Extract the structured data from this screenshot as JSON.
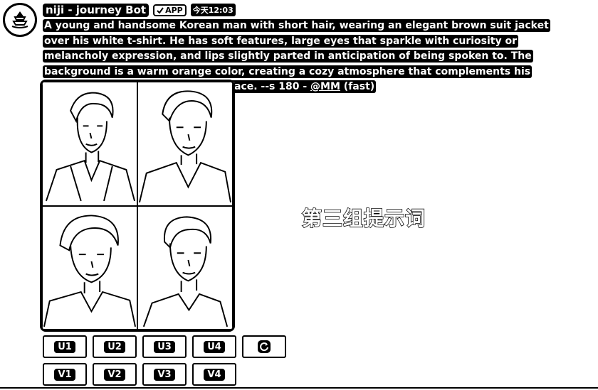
{
  "header": {
    "bot_name": "niji - journey Bot",
    "badge": "APP",
    "timestamp": "今天12:03",
    "avatar_icon": "boat-avatar-icon"
  },
  "message": {
    "prompt_text": "A young and handsome Korean man with short hair, wearing an elegant brown suit jacket over his white t-shirt. He has soft features, large eyes that sparkle with curiosity or melancholy expression, and lips slightly parted in anticipation of being spoken to. The background is a warm orange color, creating a cozy atmosphere that complements his overall style, with a focus on his face. --s 180 - ",
    "mention": "@MM",
    "suffix": " (fast)"
  },
  "annotation": "第三组提示词",
  "buttons": {
    "upscale": [
      "U1",
      "U2",
      "U3",
      "U4"
    ],
    "variations": [
      "V1",
      "V2",
      "V3",
      "V4"
    ],
    "reroll_icon": "reroll-icon"
  },
  "colors": {
    "ink": "#000000",
    "paper": "#ffffff"
  }
}
